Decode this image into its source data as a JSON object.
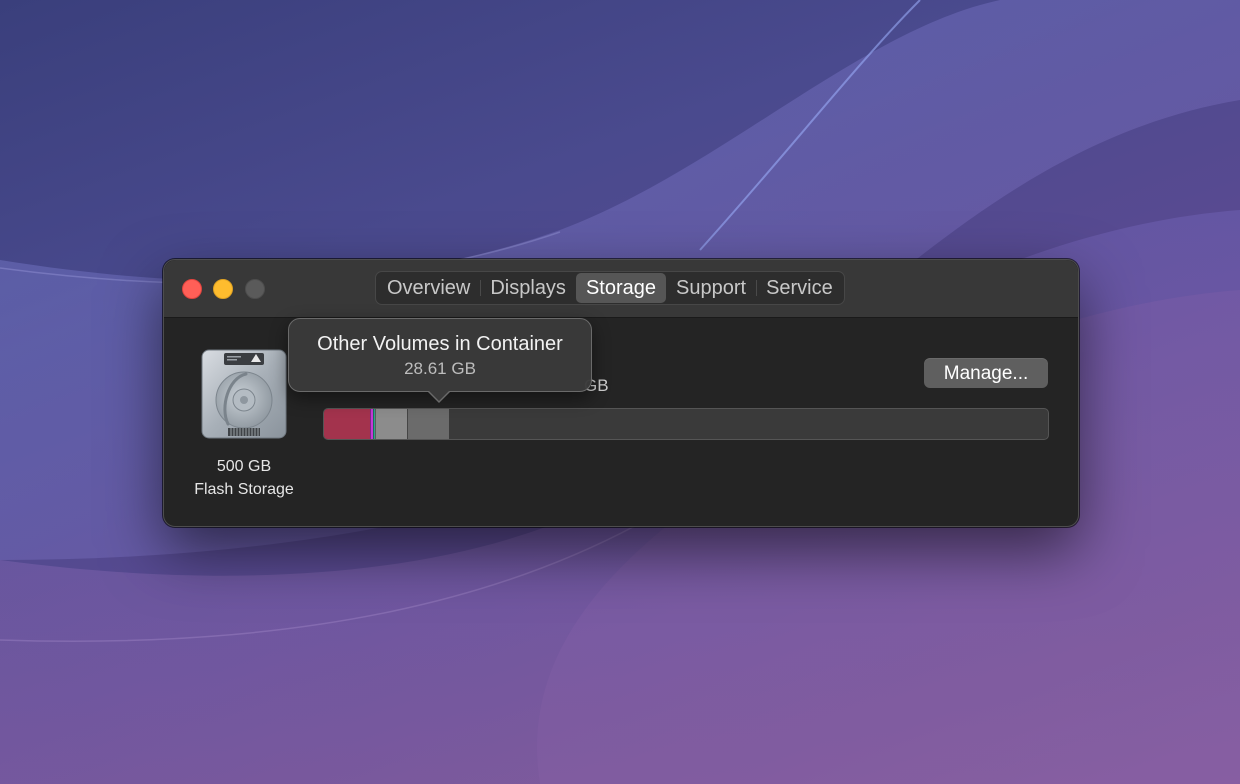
{
  "window": {
    "tabs": [
      {
        "label": "Overview",
        "selected": false
      },
      {
        "label": "Displays",
        "selected": false
      },
      {
        "label": "Storage",
        "selected": true
      },
      {
        "label": "Support",
        "selected": false
      },
      {
        "label": "Service",
        "selected": false
      }
    ]
  },
  "disk": {
    "capacity": "500 GB",
    "type": "Flash Storage",
    "icon": "hard-drive-icon"
  },
  "storage": {
    "summary": "GB",
    "manage_label": "Manage...",
    "bar": {
      "total_gb": 500,
      "segments": [
        {
          "name": "primary-usage",
          "gb": 31.5,
          "color": "#a3334d"
        },
        {
          "name": "magenta-usage",
          "gb": 2.0,
          "color": "#c43ad6"
        },
        {
          "name": "teal-usage",
          "gb": 1.4,
          "color": "#2fa58a"
        },
        {
          "name": "light-gray-usage",
          "gb": 22.5,
          "color": "#8c8c8c"
        },
        {
          "name": "other-volumes-in-container",
          "gb": 28.61,
          "color": "#6b6b6b"
        }
      ]
    }
  },
  "tooltip": {
    "title": "Other Volumes in Container",
    "value": "28.61 GB"
  },
  "colors": {
    "window_background": "#242424",
    "titlebar": "#383838",
    "close_button": "#ff5f57",
    "minimize_button": "#febc2e",
    "zoom_button_inactive": "#5a5a5a",
    "selected_tab": "#565656"
  }
}
